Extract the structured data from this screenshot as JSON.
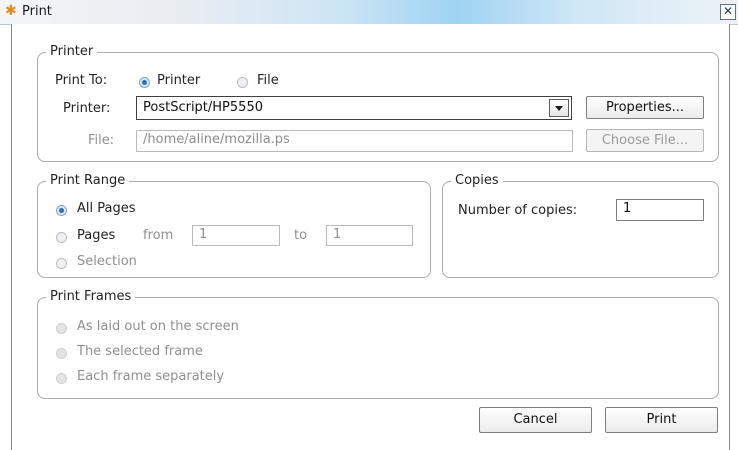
{
  "window": {
    "title": "Print",
    "close_glyph": "✕"
  },
  "printer_group": {
    "legend": "Printer",
    "print_to_label": "Print To:",
    "print_to_options": [
      "Printer",
      "File"
    ],
    "print_to_selected": "Printer",
    "printer_label": "Printer:",
    "printer_value": "PostScript/HP5550",
    "properties_button": "Properties...",
    "file_label": "File:",
    "file_value": "/home/aline/mozilla.ps",
    "choose_file_button": "Choose File..."
  },
  "print_range": {
    "legend": "Print Range",
    "all_pages": "All Pages",
    "pages": "Pages",
    "from_label": "from",
    "from_value": "1",
    "to_label": "to",
    "to_value": "1",
    "selection": "Selection",
    "selected": "All Pages"
  },
  "copies": {
    "legend": "Copies",
    "number_label": "Number of copies:",
    "number_value": "1"
  },
  "print_frames": {
    "legend": "Print Frames",
    "options": [
      "As laid out on the screen",
      "The selected frame",
      "Each frame separately"
    ]
  },
  "actions": {
    "cancel": "Cancel",
    "print": "Print"
  }
}
